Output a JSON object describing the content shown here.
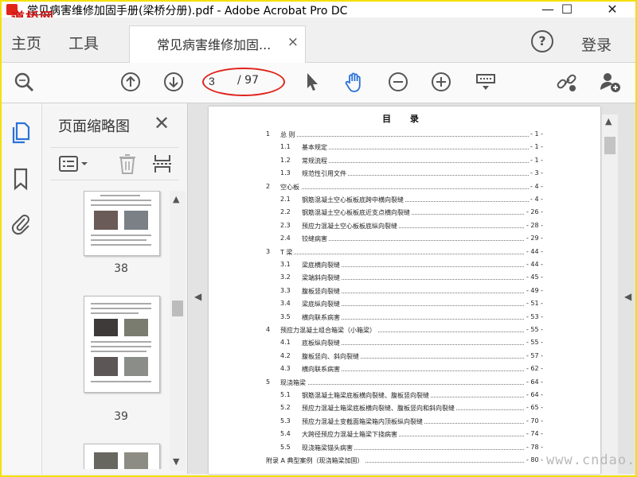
{
  "window": {
    "title": "常见病害维修加固手册(梁桥分册).pdf - Adobe Acrobat Pro DC",
    "minimize": "—",
    "maximize": "☐",
    "close": "✕"
  },
  "watermark_logo": "道桥网",
  "tabs": {
    "home": "主页",
    "tools": "工具",
    "document": "常见病害维修加固...",
    "close_symbol": "×",
    "help": "?",
    "login": "登录"
  },
  "toolbar": {
    "current_page": "3",
    "total_pages": "/ 97"
  },
  "sidebar": {
    "panel_title": "页面缩略图",
    "close_symbol": "✕",
    "thumbnails": [
      {
        "page": "38"
      },
      {
        "page": "39"
      }
    ]
  },
  "toc": {
    "title": "目 录",
    "entries": [
      {
        "num": "1",
        "text": "总 则",
        "page": "- 1 -",
        "level": 1
      },
      {
        "num": "1.1",
        "text": "基本规定",
        "page": "- 1 -",
        "level": 2
      },
      {
        "num": "1.2",
        "text": "常规流程",
        "page": "- 1 -",
        "level": 2
      },
      {
        "num": "1.3",
        "text": "规范性引用文件",
        "page": "- 3 -",
        "level": 2
      },
      {
        "num": "2",
        "text": "空心板",
        "page": "- 4 -",
        "level": 1
      },
      {
        "num": "2.1",
        "text": "钢筋混凝土空心板板底跨中横向裂缝",
        "page": "- 4 -",
        "level": 2
      },
      {
        "num": "2.2",
        "text": "钢筋混凝土空心板板底近支点横向裂缝",
        "page": "- 26 -",
        "level": 2
      },
      {
        "num": "2.3",
        "text": "预应力混凝土空心板板底纵向裂缝",
        "page": "- 28 -",
        "level": 2
      },
      {
        "num": "2.4",
        "text": "铰缝病害",
        "page": "- 29 -",
        "level": 2
      },
      {
        "num": "3",
        "text": "T 梁",
        "page": "- 44 -",
        "level": 1
      },
      {
        "num": "3.1",
        "text": "梁底横向裂缝",
        "page": "- 44 -",
        "level": 2
      },
      {
        "num": "3.2",
        "text": "梁端斜向裂缝",
        "page": "- 45 -",
        "level": 2
      },
      {
        "num": "3.3",
        "text": "腹板竖向裂缝",
        "page": "- 49 -",
        "level": 2
      },
      {
        "num": "3.4",
        "text": "梁底纵向裂缝",
        "page": "- 51 -",
        "level": 2
      },
      {
        "num": "3.5",
        "text": "横向联系病害",
        "page": "- 53 -",
        "level": 2
      },
      {
        "num": "4",
        "text": "预应力混凝土组合箱梁（小箱梁）",
        "page": "- 55 -",
        "level": 1
      },
      {
        "num": "4.1",
        "text": "底板纵向裂缝",
        "page": "- 55 -",
        "level": 2
      },
      {
        "num": "4.2",
        "text": "腹板竖向、斜向裂缝",
        "page": "- 57 -",
        "level": 2
      },
      {
        "num": "4.3",
        "text": "横向联系病害",
        "page": "- 62 -",
        "level": 2
      },
      {
        "num": "5",
        "text": "现浇箱梁",
        "page": "- 64 -",
        "level": 1
      },
      {
        "num": "5.1",
        "text": "钢筋混凝土箱梁底板横向裂缝、腹板竖向裂缝",
        "page": "- 64 -",
        "level": 2
      },
      {
        "num": "5.2",
        "text": "预应力混凝土箱梁底板横向裂缝、腹板竖向和斜向裂缝",
        "page": "- 65 -",
        "level": 2
      },
      {
        "num": "5.3",
        "text": "预应力混凝土变截面箱梁箱内顶板纵向裂缝",
        "page": "- 70 -",
        "level": 2
      },
      {
        "num": "5.4",
        "text": "大跨径预应力混凝土箱梁下挠病害",
        "page": "- 74 -",
        "level": 2
      },
      {
        "num": "5.5",
        "text": "现浇箱梁锚头病害",
        "page": "- 78 -",
        "level": 2
      },
      {
        "num": "",
        "text": "附录 A 典型案例（现浇箱梁加固）",
        "page": "- 80 -",
        "level": 0
      }
    ]
  },
  "site_watermark": "www.cndao.com",
  "colors": {
    "accent_blue": "#2a72d9",
    "annotation_red": "#e0231b",
    "window_border": "#f3e000"
  }
}
